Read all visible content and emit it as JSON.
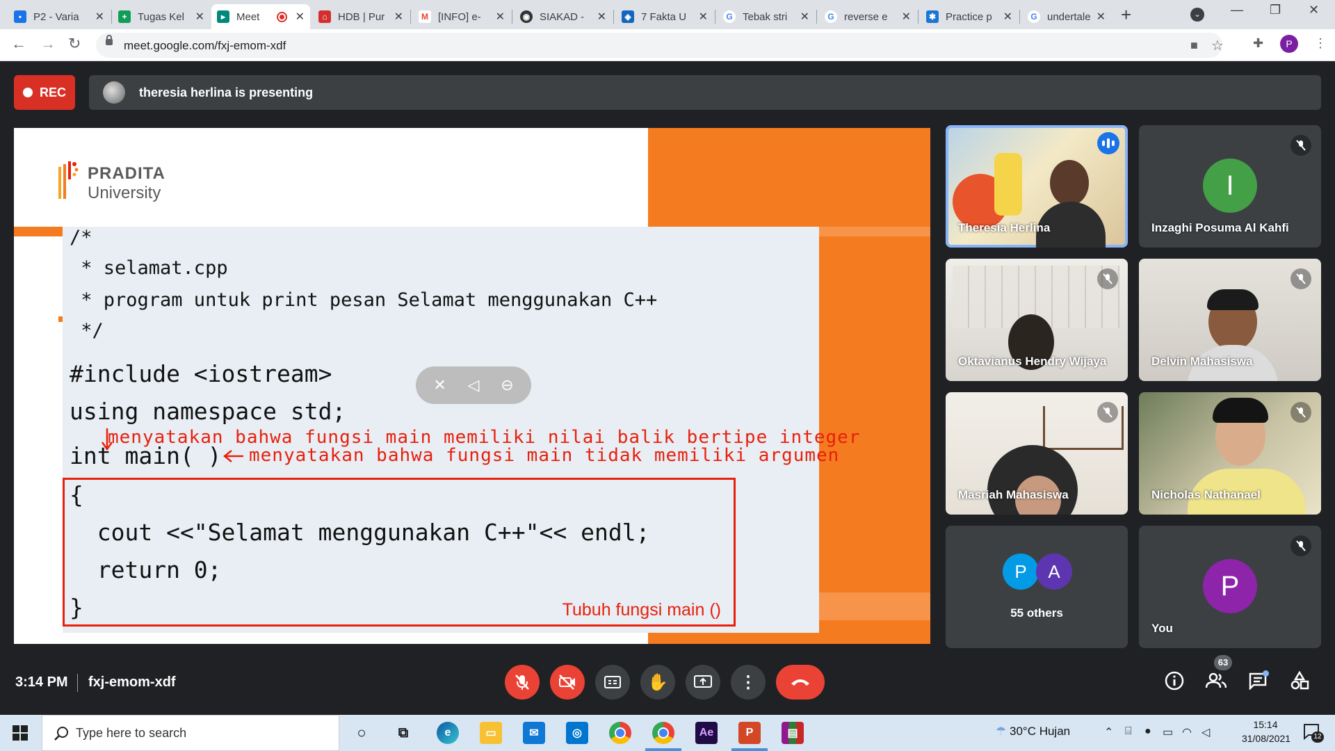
{
  "browser": {
    "tabs": [
      {
        "title": "P2 - Varia",
        "favicon": "contacts-icon",
        "color": "#1a73e8"
      },
      {
        "title": "Tugas Kel",
        "favicon": "sheets-icon",
        "color": "#0f9d58"
      },
      {
        "title": "Meet",
        "favicon": "meet-icon",
        "color": "#00897b",
        "active": true,
        "recording": true
      },
      {
        "title": "HDB | Pur",
        "favicon": "hdb-icon",
        "color": "#d32f2f"
      },
      {
        "title": "[INFO] e-",
        "favicon": "gmail-icon",
        "color": "#ea4335"
      },
      {
        "title": "SIAKAD -",
        "favicon": "siakad-icon",
        "color": "#333333"
      },
      {
        "title": "7 Fakta U",
        "favicon": "shield-icon",
        "color": "#1565c0"
      },
      {
        "title": "Tebak stri",
        "favicon": "google-icon",
        "color": "#4285f4"
      },
      {
        "title": "reverse e",
        "favicon": "google-icon",
        "color": "#4285f4"
      },
      {
        "title": "Practice p",
        "favicon": "practice-icon",
        "color": "#1976d2"
      },
      {
        "title": "undertale",
        "favicon": "google-icon",
        "color": "#4285f4"
      }
    ],
    "new_tab": "+",
    "url": "meet.google.com/fxj-emom-xdf",
    "profile_initial": "P"
  },
  "meet": {
    "rec_label": "REC",
    "presenting_text": "theresia herlina is presenting",
    "time": "3:14 PM",
    "meeting_code": "fxj-emom-xdf",
    "people_count": "63"
  },
  "slide": {
    "logo_name": "PRADITA",
    "logo_sub": "University",
    "code_lines": {
      "c1": "/*",
      "c2": " * selamat.cpp",
      "c3": " * program untuk print pesan Selamat menggunakan C++",
      "c4": " */",
      "c5": "#include <iostream>",
      "c6": "using namespace std;",
      "c7": "int main( )",
      "c8": "{",
      "c9": "  cout <<\"Selamat menggunakan C++\"<< endl;",
      "c10": "  return 0;",
      "c11": "}"
    },
    "annotation_1": "menyatakan bahwa fungsi main memiliki nilai balik bertipe integer",
    "annotation_2": "menyatakan bahwa fungsi main tidak memiliki argumen",
    "box_caption": "Tubuh fungsi main ()"
  },
  "participants": [
    {
      "name": "Theresia Herlina",
      "speaking": true
    },
    {
      "name": "Inzaghi Posuma Al Kahfi",
      "initial": "I",
      "color": "#43a047",
      "muted": true
    },
    {
      "name": "Oktavianus Hendry Wijaya",
      "muted": true
    },
    {
      "name": "Delvin Mahasiswa",
      "muted": true
    },
    {
      "name": "Masriah Mahasiswa",
      "muted": true
    },
    {
      "name": "Nicholas Nathanael",
      "muted": true
    },
    {
      "name": "55 others",
      "initials": [
        "P",
        "A"
      ],
      "colors": [
        "#039be5",
        "#5e35b1"
      ]
    },
    {
      "name": "You",
      "initial": "P",
      "color": "#8e24aa",
      "muted": true
    }
  ],
  "taskbar": {
    "search_placeholder": "Type here to search",
    "weather": "30°C  Hujan",
    "time": "15:14",
    "date": "31/08/2021",
    "notification_count": "12",
    "apps": [
      "task-view-icon",
      "edge-icon",
      "file-explorer-icon",
      "mail-icon",
      "dell-icon",
      "chrome-icon",
      "chrome-profile-icon",
      "after-effects-icon",
      "powerpoint-icon",
      "winrar-icon"
    ]
  }
}
